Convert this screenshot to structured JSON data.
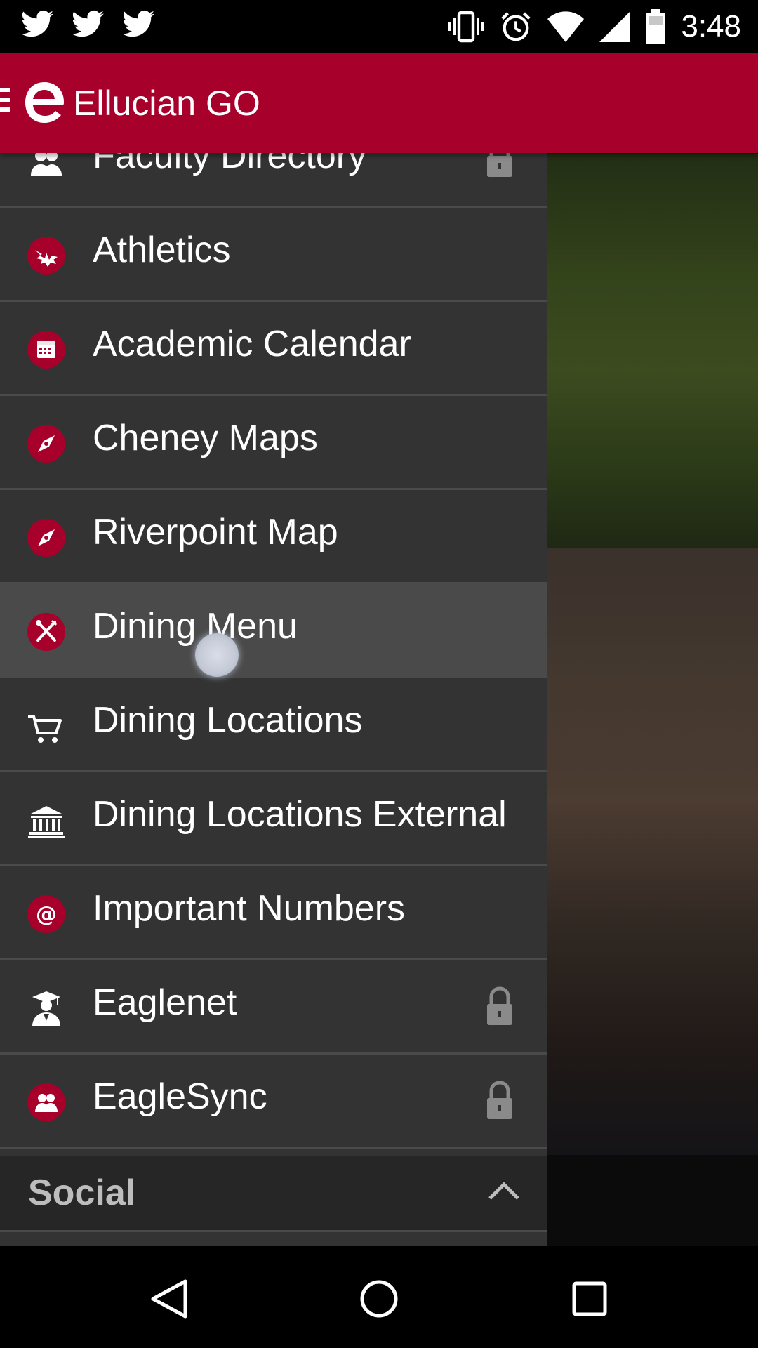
{
  "status_bar": {
    "time": "3:48",
    "left_icons": [
      "twitter-icon",
      "twitter-icon",
      "twitter-icon"
    ],
    "right_icons": [
      "vibrate-icon",
      "alarm-icon",
      "wifi-icon",
      "signal-icon",
      "battery-icon"
    ]
  },
  "app_bar": {
    "title": "Ellucian GO",
    "color": "#a6002b"
  },
  "drawer": {
    "items": [
      {
        "label": "Faculty Directory",
        "icon": "people-icon",
        "locked": true
      },
      {
        "label": "Athletics",
        "icon": "eagle-icon",
        "locked": false
      },
      {
        "label": "Academic Calendar",
        "icon": "calendar-icon",
        "locked": false
      },
      {
        "label": "Cheney Maps",
        "icon": "compass-icon",
        "locked": false
      },
      {
        "label": "Riverpoint Map",
        "icon": "compass-icon",
        "locked": false
      },
      {
        "label": "Dining Menu",
        "icon": "fork-knife-icon",
        "locked": false,
        "highlighted": true
      },
      {
        "label": "Dining Locations",
        "icon": "cart-icon",
        "locked": false
      },
      {
        "label": "Dining Locations External",
        "icon": "bank-icon",
        "locked": false
      },
      {
        "label": "Important Numbers",
        "icon": "at-icon",
        "locked": false
      },
      {
        "label": "Eaglenet",
        "icon": "graduate-icon",
        "locked": true
      },
      {
        "label": "EagleSync",
        "icon": "people-circle-icon",
        "locked": true
      }
    ],
    "section": {
      "label": "Social",
      "expanded": true
    }
  },
  "nav_bar": {
    "buttons": [
      "back-icon",
      "home-icon",
      "recents-icon"
    ]
  }
}
